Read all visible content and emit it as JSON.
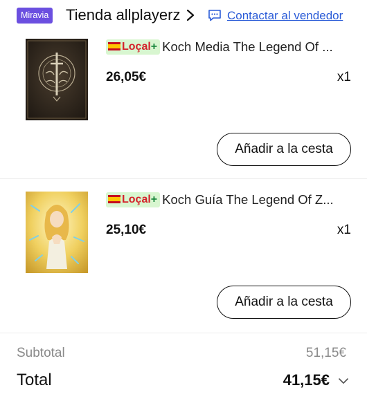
{
  "header": {
    "badge": "Miravia",
    "store_name": "Tienda allplayerz",
    "contact_label": "Contactar al vendedor",
    "chevron_icon": "chevron-right-icon",
    "chat_icon": "chat-icon",
    "link_color": "#2a5bd7",
    "badge_color": "#6b4fe0"
  },
  "products": [
    {
      "tag_local": "Loçal",
      "tag_plus": "+",
      "title": "Koch Media The Legend Of ...",
      "price": "26,05€",
      "qty": "x1",
      "add_label": "Añadir a la cesta"
    },
    {
      "tag_local": "Loçal",
      "tag_plus": "+",
      "title": "Koch Guía The Legend Of Z...",
      "price": "25,10€",
      "qty": "x1",
      "add_label": "Añadir a la cesta"
    }
  ],
  "summary": {
    "subtotal_label": "Subtotal",
    "subtotal_value": "51,15€",
    "total_label": "Total",
    "total_value": "41,15€",
    "expand_icon": "chevron-down-icon"
  }
}
